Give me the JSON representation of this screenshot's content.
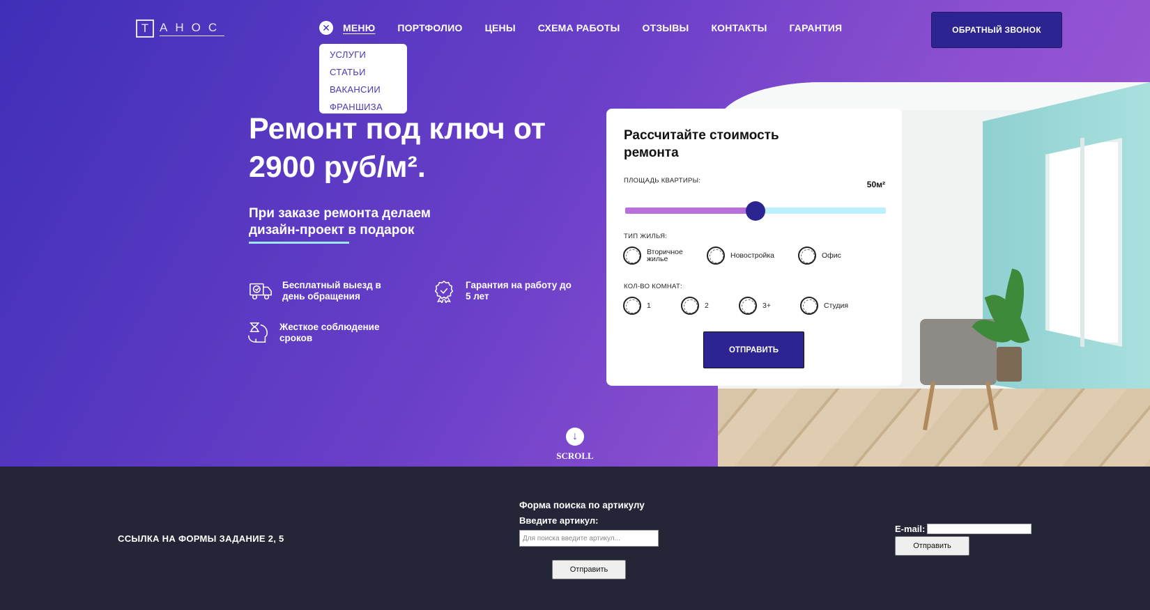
{
  "logo": {
    "first_letter": "Т",
    "rest": "АНОС"
  },
  "nav": {
    "close_glyph": "✕",
    "items": [
      "МЕНЮ",
      "ПОРТФОЛИО",
      "ЦЕНЫ",
      "СХЕМА РАБОТЫ",
      "ОТЗЫВЫ",
      "КОНТАКТЫ",
      "ГАРАНТИЯ"
    ],
    "dropdown": [
      "УСЛУГИ",
      "СТАТЬИ",
      "ВАКАНСИИ",
      "ФРАНШИЗА"
    ]
  },
  "header": {
    "callback_label": "ОБРАТНЫЙ ЗВОНОК"
  },
  "hero": {
    "title": "Ремонт под ключ от 2900 руб/м².",
    "subtitle": "При заказе ремонта делаем дизайн-проект в подарок",
    "features": [
      {
        "icon": "truck-icon",
        "text": "Бесплатный выезд в день обращения"
      },
      {
        "icon": "medal-icon",
        "text": "Гарантия на работу до 5 лет"
      },
      {
        "icon": "hourglass-head-icon",
        "text": "Жесткое соблюдение сроков"
      }
    ],
    "scroll_label": "SCROLL"
  },
  "calculator": {
    "title": "Рассчитайте стоимость ремонта",
    "area_label": "ПЛОЩАДЬ КВАРТИРЫ:",
    "area_value": "50м²",
    "area_fraction": 0.5,
    "housing_label": "ТИП ЖИЛЬЯ:",
    "housing_options": [
      "Вторичное жилье",
      "Новостройка",
      "Офис"
    ],
    "rooms_label": "КОЛ-ВО КОМНАТ:",
    "rooms_options": [
      "1",
      "2",
      "3+",
      "Студия"
    ],
    "submit_label": "ОТПРАВИТЬ"
  },
  "footer": {
    "link_text": "ССЫЛКА НА ФОРМЫ ЗАДАНИЕ 2, 5",
    "search": {
      "title": "Форма поиска по артикулу",
      "label": "Введите артикул:",
      "placeholder": "Для поиска введите артикул...",
      "submit": "Отправить"
    },
    "email": {
      "label": "E-mail:",
      "submit": "Отправить"
    }
  },
  "colors": {
    "accent": "#2c2491",
    "gradient_start": "#3f2fb8",
    "gradient_end": "#a35cd6",
    "footer_bg": "#242638",
    "slider_fill": "#b96fd9",
    "slider_track": "#bcefff"
  }
}
